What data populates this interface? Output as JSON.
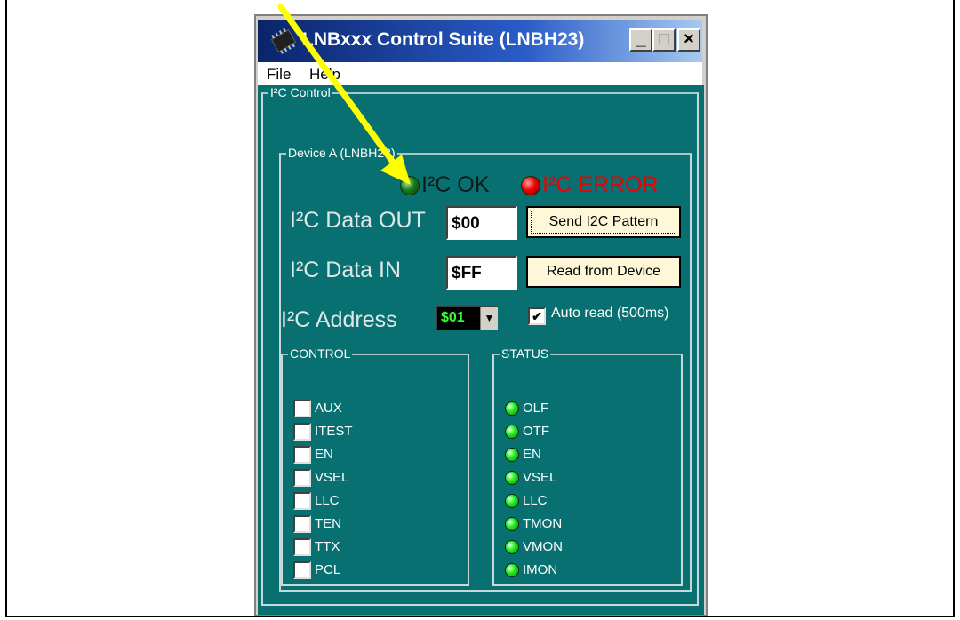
{
  "window": {
    "title": "LNBxxx Control Suite  (LNBH23)"
  },
  "titlebar": {
    "min_label": "_",
    "max_label": "□",
    "close_label": "×"
  },
  "menu": {
    "file": "File",
    "help": "Help"
  },
  "i2c_control": {
    "label": "I²C Control",
    "device_group_label": "Device A (LNBH23)",
    "ok_label": "I²C OK",
    "error_label": "I²C ERROR",
    "data_out_label": "I²C Data  OUT",
    "data_out_value": "$00",
    "send_button": "Send I2C Pattern",
    "data_in_label": "I²C Data IN",
    "data_in_value": "$FF",
    "read_button": "Read from Device",
    "address_label": "I²C Address",
    "address_value": "$01",
    "auto_read_label": "Auto read (500ms)",
    "auto_read_checked": true
  },
  "control": {
    "label": "CONTROL",
    "items": [
      {
        "label": "AUX",
        "checked": false
      },
      {
        "label": "ITEST",
        "checked": false
      },
      {
        "label": "EN",
        "checked": false
      },
      {
        "label": "VSEL",
        "checked": false
      },
      {
        "label": "LLC",
        "checked": false
      },
      {
        "label": "TEN",
        "checked": false
      },
      {
        "label": "TTX",
        "checked": false
      },
      {
        "label": "PCL",
        "checked": false
      }
    ]
  },
  "status": {
    "label": "STATUS",
    "items": [
      {
        "label": "OLF"
      },
      {
        "label": "OTF"
      },
      {
        "label": "EN"
      },
      {
        "label": "VSEL"
      },
      {
        "label": "LLC"
      },
      {
        "label": "TMON"
      },
      {
        "label": "VMON"
      },
      {
        "label": "IMON"
      }
    ]
  },
  "colors": {
    "panel_bg": "#087070",
    "ok_led": "#1a7a1a",
    "error_led": "#ee0000",
    "error_text": "#ee0000",
    "status_led": "#22ee22",
    "annotation_arrow": "#ffff00"
  },
  "icons": {
    "app": "chip-icon",
    "annotation": "arrow-annotation-icon"
  }
}
